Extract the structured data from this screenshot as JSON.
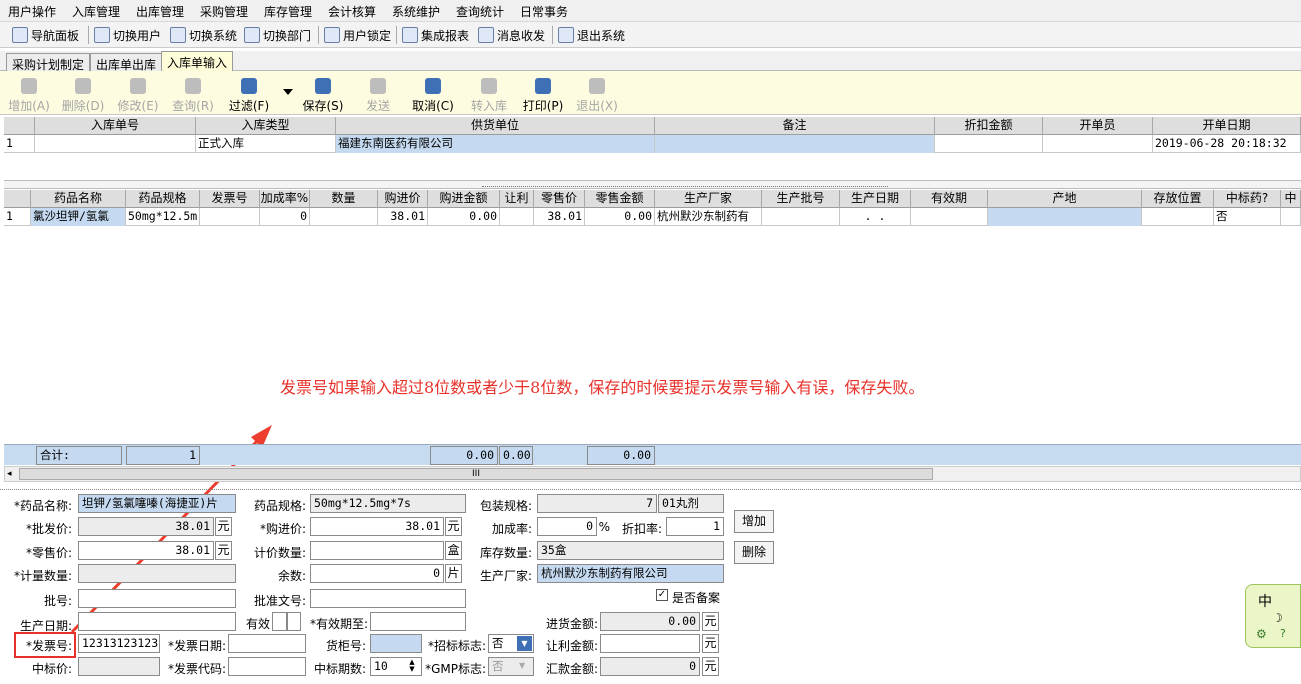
{
  "menu": [
    "用户操作",
    "入库管理",
    "出库管理",
    "采购管理",
    "库存管理",
    "会计核算",
    "系统维护",
    "查询统计",
    "日常事务"
  ],
  "toolbar": [
    "导航面板",
    "切换用户",
    "切换系统",
    "切换部门",
    "用户锁定",
    "集成报表",
    "消息收发",
    "退出系统"
  ],
  "tabs": [
    "采购计划制定",
    "出库单出库",
    "入库单输入"
  ],
  "actions": [
    "增加(A)",
    "删除(D)",
    "修改(E)",
    "查询(R)",
    "过滤(F)",
    "保存(S)",
    "发送",
    "取消(C)",
    "转入库",
    "打印(P)",
    "退出(X)"
  ],
  "header_grid": {
    "columns": [
      "",
      "入库单号",
      "入库类型",
      "供货单位",
      "备注",
      "折扣金额",
      "开单员",
      "开单日期"
    ],
    "row": [
      "1",
      "",
      "正式入库",
      "福建东南医药有限公司",
      "",
      "",
      "",
      "2019-06-28 20:18:32"
    ]
  },
  "detail_grid": {
    "columns": [
      "",
      "药品名称",
      "药品规格",
      "发票号",
      "加成率%",
      "数量",
      "购进价",
      "购进金额",
      "让利",
      "零售价",
      "零售金额",
      "生产厂家",
      "生产批号",
      "生产日期",
      "有效期",
      "产地",
      "存放位置",
      "中标药?",
      "中"
    ],
    "row": [
      "1",
      "氯沙坦钾/氢氯",
      "50mg*12.5m",
      "",
      "0",
      "",
      "38.01",
      "0.00",
      "",
      "38.01",
      "0.00",
      "杭州默沙东制药有",
      "",
      ". .",
      "",
      "",
      "",
      "否",
      ""
    ]
  },
  "annotation": "发票号如果输入超过8位数或者少于8位数，保存的时候要提示发票号输入有误，保存失败。",
  "totals": {
    "label": "合计:",
    "count": "1",
    "v1": "0.00",
    "v2": "0.00",
    "v3": "0.00",
    "scroll": "III"
  },
  "form": {
    "drug_name_label": "*药品名称:",
    "drug_name": "坦钾/氢氯噻嗪(海捷亚)片",
    "spec_label": "药品规格:",
    "spec": "50mg*12.5mg*7s",
    "pack_label": "包装规格:",
    "pack_qty": "7",
    "pack_unit": "01丸剂",
    "wholesale_label": "*批发价:",
    "wholesale": "38.01",
    "yuan": "元",
    "purchase_label": "*购进价:",
    "purchase": "38.01",
    "markup_label": "加成率:",
    "markup": "0",
    "pct": "%",
    "discount_label": "折扣率:",
    "discount": "1",
    "add_btn": "增加",
    "del_btn": "删除",
    "retail_label": "*零售价:",
    "retail": "38.01",
    "count_qty_label": "计价数量:",
    "box": "盒",
    "stock_label": "库存数量:",
    "stock": "35盒",
    "measure_label": "*计量数量:",
    "remain_label": "余数:",
    "remain": "0",
    "piece": "片",
    "maker_label": "生产厂家:",
    "maker": "杭州默沙东制药有限公司",
    "batch_label": "批号:",
    "approval_label": "批准文号:",
    "record_label": "是否备案",
    "prod_date_label": "生产日期:",
    "valid_label": "有效",
    "valid_to_label": "*有效期至:",
    "in_amount_label": "进货金额:",
    "in_amount": "0.00",
    "invoice_label": "*发票号:",
    "invoice": "12313123123",
    "invoice_date_label": "*发票日期:",
    "cabinet_label": "货柜号:",
    "bid_label": "*招标标志:",
    "bid": "否",
    "rebate_label": "让利金额:",
    "bid_price_label": "中标价:",
    "invoice_code_label": "*发票代码:",
    "bid_period_label": "中标期数:",
    "bid_period": "10",
    "gmp_label": "*GMP标志:",
    "gmp": "否",
    "remit_label": "汇款金额:",
    "remit": "0"
  },
  "ime": {
    "lang": "中"
  }
}
